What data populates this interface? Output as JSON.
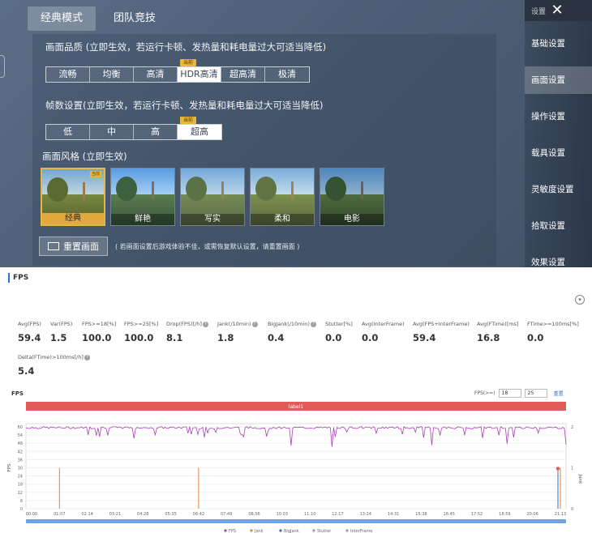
{
  "game": {
    "tabs": [
      {
        "label": "经典模式",
        "active": true
      },
      {
        "label": "团队竞技",
        "active": false
      }
    ],
    "quality": {
      "title": "画面品质 (立即生效，若运行卡顿、发热量和耗电量过大可适当降低)",
      "options": [
        "流畅",
        "均衡",
        "高清",
        "HDR高清",
        "超高清",
        "极清"
      ],
      "selected_index": 3
    },
    "framerate": {
      "title": "帧数设置(立即生效，若运行卡顿、发热量和耗电量过大可适当降低)",
      "options": [
        "低",
        "中",
        "高",
        "超高"
      ],
      "selected_index": 3
    },
    "current_tag": "当前",
    "style": {
      "title": "画面风格 (立即生效)",
      "options": [
        "经典",
        "鲜艳",
        "写实",
        "柔和",
        "电影"
      ],
      "selected_index": 0
    },
    "reset_label": "重置画面",
    "reset_note": "( 若画面设置后游戏体验不佳，或需恢复默认设置，请重置画面 )",
    "settings_label": "设置",
    "sidebar": [
      {
        "label": "基础设置",
        "active": false
      },
      {
        "label": "画面设置",
        "active": true
      },
      {
        "label": "操作设置",
        "active": false
      },
      {
        "label": "载具设置",
        "active": false
      },
      {
        "label": "灵敏度设置",
        "active": false
      },
      {
        "label": "拾取设置",
        "active": false
      },
      {
        "label": "效果设置",
        "active": false
      }
    ]
  },
  "fps_panel": {
    "header": "FPS",
    "metrics": [
      {
        "label": "Avg(FPS)",
        "value": "59.4",
        "help": false
      },
      {
        "label": "Var(FPS)",
        "value": "1.5",
        "help": false
      },
      {
        "label": "FPS>=18[%]",
        "value": "100.0",
        "help": false
      },
      {
        "label": "FPS>=25[%]",
        "value": "100.0",
        "help": false
      },
      {
        "label": "Drop(FPS)[/h]",
        "value": "8.1",
        "help": true
      },
      {
        "label": "Jank(/10min)",
        "value": "1.8",
        "help": true
      },
      {
        "label": "BigJank(/10min)",
        "value": "0.4",
        "help": true
      },
      {
        "label": "Stutter[%]",
        "value": "0.0",
        "help": false
      },
      {
        "label": "Avg(InterFrame)",
        "value": "0.0",
        "help": false
      },
      {
        "label": "Avg(FPS+InterFrame)",
        "value": "59.4",
        "help": false
      },
      {
        "label": "Avg(FTime)[ms]",
        "value": "16.8",
        "help": false
      },
      {
        "label": "FTime>=100ms[%]",
        "value": "0.0",
        "help": false
      },
      {
        "label": "Delta(FTime)>100ms[/h]",
        "value": "5.4",
        "help": true
      }
    ],
    "chart_title": "FPS",
    "filter_label": "FPS(>=)",
    "filter_values": [
      "18",
      "25"
    ],
    "filter_reset": "重置",
    "collapse_icon": "chevron-down-icon",
    "colors": {
      "fps": "#a83fb5",
      "jank": "#e8803a",
      "bigjank": "#2a6fd6",
      "band": "#e25a5a",
      "scroll": "#6fa4e0"
    }
  },
  "chart_data": {
    "type": "line",
    "band_label": "label1",
    "ylabel_left": "FPS",
    "ylabel_right": "Jank",
    "y_ticks": [
      0,
      6,
      12,
      18,
      24,
      30,
      36,
      42,
      48,
      54,
      60
    ],
    "ylim": [
      0,
      60
    ],
    "y2_ticks": [
      0,
      1,
      2
    ],
    "y2lim": [
      0,
      2
    ],
    "x_ticks": [
      "00:00",
      "01:07",
      "02:14",
      "03:21",
      "04:28",
      "05:35",
      "06:42",
      "07:49",
      "08:56",
      "10:03",
      "11:10",
      "12:17",
      "13:24",
      "14:31",
      "15:38",
      "16:45",
      "17:52",
      "18:59",
      "20:06",
      "21:13"
    ],
    "legend": [
      "FPS",
      "Jank",
      "BigJank",
      "Stutter",
      "InterFrame"
    ],
    "series": [
      {
        "name": "FPS",
        "description_values": {
          "typical": 59.4,
          "min_dip": 45
        }
      },
      {
        "name": "Jank",
        "events_x": [
          "01:07",
          "06:42",
          "21:13"
        ],
        "values": [
          1,
          1,
          1
        ]
      },
      {
        "name": "BigJank",
        "events_x": [
          "21:13"
        ],
        "values": [
          1
        ]
      }
    ]
  }
}
